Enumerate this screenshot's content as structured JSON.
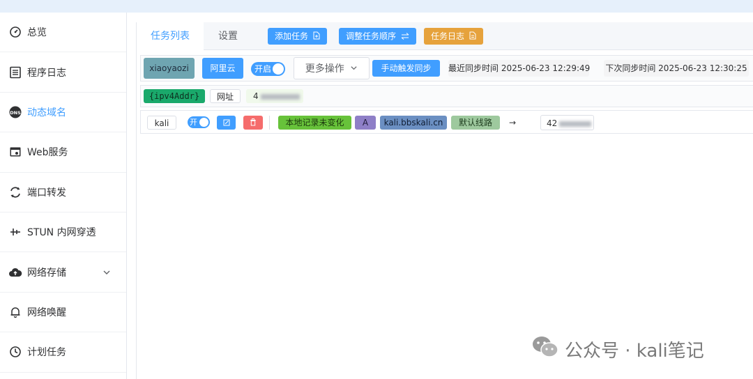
{
  "sidebar": {
    "items": [
      {
        "label": "总览",
        "icon": "dashboard-icon"
      },
      {
        "label": "程序日志",
        "icon": "log-icon"
      },
      {
        "label": "动态域名",
        "icon": "dns-icon"
      },
      {
        "label": "Web服务",
        "icon": "web-icon"
      },
      {
        "label": "端口转发",
        "icon": "port-forward-icon"
      },
      {
        "label": "STUN 内网穿透",
        "icon": "stun-icon"
      },
      {
        "label": "网络存储",
        "icon": "cloud-icon"
      },
      {
        "label": "网络唤醒",
        "icon": "bell-icon"
      },
      {
        "label": "计划任务",
        "icon": "clock-icon"
      }
    ],
    "active_color": "#409eff"
  },
  "tabs": {
    "list": "任务列表",
    "settings": "设置"
  },
  "toolbar": {
    "add_task": "添加任务",
    "reorder": "调整任务顺序",
    "task_log": "任务日志"
  },
  "task": {
    "name": "xiaoyaozi",
    "provider": "阿里云",
    "switch": "开启",
    "more_ops": "更多操作",
    "manual_sync": "手动触发同步",
    "last_sync": "最近同步时间 2025-06-23 12:29:49",
    "next_sync": "下次同步时间 2025-06-23 12:30:25",
    "var_tag": "{ipv4Addr}",
    "url_label": "网址",
    "ip_prefix": "4",
    "record": {
      "host": "kali",
      "switch": "开",
      "status": "本地记录未变化",
      "type": "A",
      "domain": "kali.bbskali.cn",
      "line": "默认线路",
      "arrow": "→",
      "ip_prefix": "42"
    }
  },
  "watermark": {
    "text": "公众号 · kali笔记"
  }
}
